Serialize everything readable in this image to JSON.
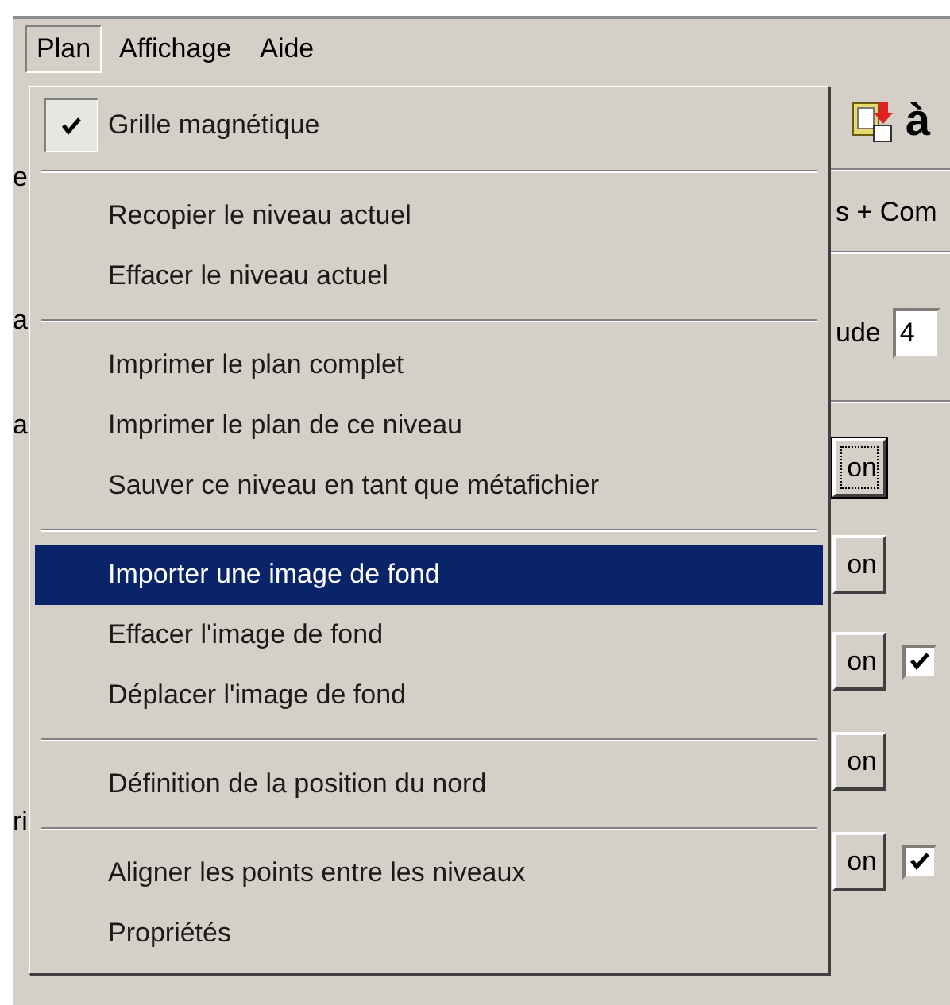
{
  "menubar": [
    {
      "label": "Plan",
      "selected": true
    },
    {
      "label": "Affichage",
      "selected": false
    },
    {
      "label": "Aide",
      "selected": false
    }
  ],
  "menu": [
    {
      "kind": "item",
      "label": "Grille magnétique",
      "checked": true,
      "selected": false
    },
    {
      "kind": "separator"
    },
    {
      "kind": "item",
      "label": "Recopier le niveau actuel",
      "checked": false,
      "selected": false
    },
    {
      "kind": "item",
      "label": "Effacer le niveau actuel",
      "checked": false,
      "selected": false
    },
    {
      "kind": "separator"
    },
    {
      "kind": "item",
      "label": "Imprimer le plan complet",
      "checked": false,
      "selected": false
    },
    {
      "kind": "item",
      "label": "Imprimer le plan de ce niveau",
      "checked": false,
      "selected": false
    },
    {
      "kind": "item",
      "label": "Sauver ce niveau en tant que métafichier",
      "checked": false,
      "selected": false
    },
    {
      "kind": "separator"
    },
    {
      "kind": "item",
      "label": "Importer une image de fond",
      "checked": false,
      "selected": true
    },
    {
      "kind": "item",
      "label": "Effacer l'image de fond",
      "checked": false,
      "selected": false
    },
    {
      "kind": "item",
      "label": "Déplacer l'image de fond",
      "checked": false,
      "selected": false
    },
    {
      "kind": "separator"
    },
    {
      "kind": "item",
      "label": "Définition de la position du nord",
      "checked": false,
      "selected": false
    },
    {
      "kind": "separator"
    },
    {
      "kind": "item",
      "label": "Aligner les points entre les niveaux",
      "checked": false,
      "selected": false
    },
    {
      "kind": "item",
      "label": "Propriétés",
      "checked": false,
      "selected": false
    }
  ],
  "background": {
    "toolbar_glyph": "à",
    "tab_label": "s + Com",
    "field_label": "ude",
    "field_value": "4",
    "left_fragments": [
      "e",
      "a",
      "a",
      "ri"
    ],
    "buttons": [
      {
        "label": "on",
        "focused": true
      },
      {
        "label": "on",
        "focused": false
      },
      {
        "label": "on",
        "focused": false,
        "checked": true
      },
      {
        "label": "on",
        "focused": false
      },
      {
        "label": "on",
        "focused": false,
        "checked": true
      }
    ]
  }
}
